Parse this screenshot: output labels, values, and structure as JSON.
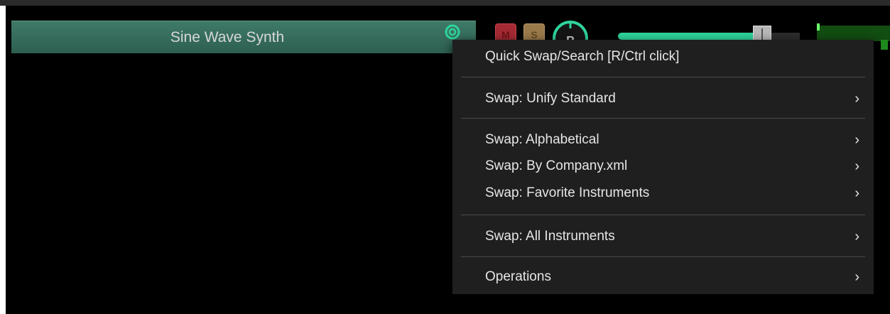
{
  "track": {
    "name": "Sine Wave Synth",
    "mute_label": "M",
    "solo_label": "S",
    "record_label": "R",
    "volume_level": 0.77
  },
  "menu": {
    "items": [
      {
        "label": "Quick Swap/Search [R/Ctrl click]",
        "submenu": false
      },
      {
        "label": "Swap: Unify Standard",
        "submenu": true
      },
      {
        "label": "Swap: Alphabetical",
        "submenu": true
      },
      {
        "label": "Swap: By Company.xml",
        "submenu": true
      },
      {
        "label": "Swap: Favorite Instruments",
        "submenu": true
      },
      {
        "label": "Swap: All Instruments",
        "submenu": true
      },
      {
        "label": "Operations",
        "submenu": true
      }
    ],
    "chevron": "›"
  },
  "colors": {
    "track_header": "#3f7a68",
    "fader_fill": "#2fd49c",
    "mute": "#a52a33",
    "solo": "#9a7a4a",
    "menu_bg": "#1f1f1f"
  }
}
